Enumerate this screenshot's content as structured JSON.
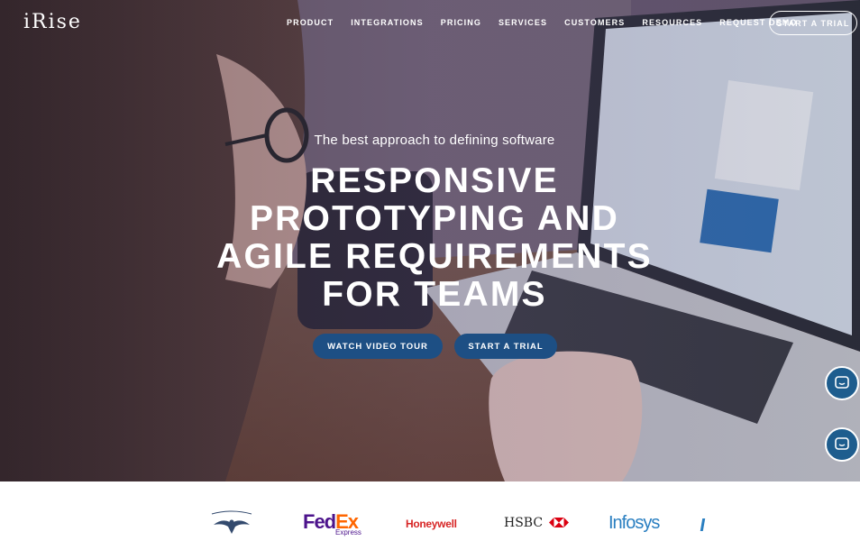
{
  "brand": {
    "logo_text": "iRise"
  },
  "nav": {
    "items": [
      "PRODUCT",
      "INTEGRATIONS",
      "PRICING",
      "SERVICES",
      "CUSTOMERS",
      "RESOURCES",
      "REQUEST DEMO"
    ],
    "cta": "START A TRIAL"
  },
  "hero": {
    "tagline": "The best approach to defining software",
    "headline_lines": [
      "RESPONSIVE",
      "PROTOTYPING AND",
      "AGILE REQUIREMENTS",
      "FOR TEAMS"
    ],
    "primary_button": "WATCH VIDEO TOUR",
    "secondary_button": "START A TRIAL"
  },
  "chat": {
    "icon": "chat-bubble-icon"
  },
  "clients": {
    "fedex_fed": "Fed",
    "fedex_ex": "Ex",
    "fedex_sub": "Express",
    "honeywell": "Honeywell",
    "hsbc": "HSBC",
    "infosys": "Infosys"
  },
  "colors": {
    "button_blue": "#1d4f84",
    "chat_blue": "#1e5d8e",
    "fedex_purple": "#4d148c",
    "fedex_orange": "#ff6600",
    "honeywell_red": "#d72525",
    "infosys_blue": "#2a7fc1"
  }
}
